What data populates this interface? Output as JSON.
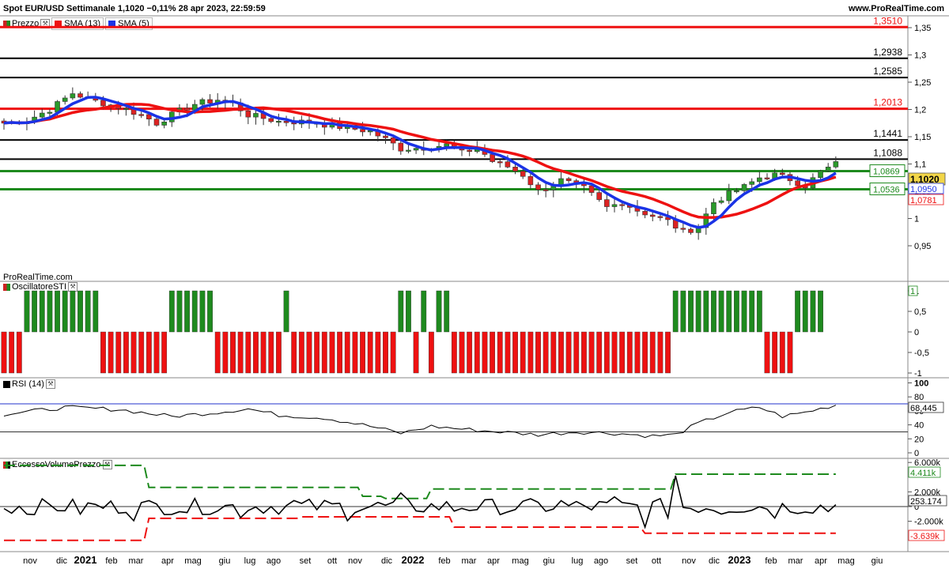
{
  "header": {
    "title": "Spot EUR/USD Settimanale 1,1020 −0,11% 28 apr 2023, 22:59:59",
    "url": "www.ProRealTime.com",
    "watermark": "ProRealTime.com"
  },
  "colors": {
    "green": "#1e8a1e",
    "red": "#e11",
    "blue": "#1a33e6",
    "black": "#000",
    "price_label_bg": "#f2d648"
  },
  "panels": [
    {
      "id": "price",
      "legend": [
        "Prezzo",
        "SMA (13)",
        "SMA (5)"
      ]
    },
    {
      "id": "sti",
      "legend": [
        "OscillatoreSTI"
      ]
    },
    {
      "id": "rsi",
      "legend": [
        "RSI (14)"
      ]
    },
    {
      "id": "evp",
      "legend": [
        "EccessoVolumePrezzo"
      ]
    }
  ],
  "chart_data": [
    {
      "type": "candlestick",
      "title": "Spot EUR/USD Settimanale",
      "timeframe": "weekly",
      "x_ticks": [
        "nov",
        "dic",
        "2021",
        "feb",
        "mar",
        "apr",
        "mag",
        "giu",
        "lug",
        "ago",
        "set",
        "ott",
        "nov",
        "dic",
        "2022",
        "feb",
        "mar",
        "apr",
        "mag",
        "giu",
        "lug",
        "ago",
        "set",
        "ott",
        "nov",
        "dic",
        "2023",
        "feb",
        "mar",
        "apr",
        "mag",
        "giu"
      ],
      "y_ticks": [
        "1,35",
        "1,3",
        "1,25",
        "1,2",
        "1,15",
        "1,1",
        "1,05",
        "1",
        "0,95"
      ],
      "ylim": [
        0.94,
        1.365
      ],
      "horizontal_levels": [
        {
          "value": 1.351,
          "label": "1,3510",
          "color": "red"
        },
        {
          "value": 1.2938,
          "label": "1,2938",
          "color": "black"
        },
        {
          "value": 1.2585,
          "label": "1,2585",
          "color": "black"
        },
        {
          "value": 1.2013,
          "label": "1,2013",
          "color": "red"
        },
        {
          "value": 1.1441,
          "label": "1,1441",
          "color": "black"
        },
        {
          "value": 1.1088,
          "label": "1,1088",
          "color": "black"
        },
        {
          "value": 1.0869,
          "label": "1,0869",
          "color": "green"
        },
        {
          "value": 1.0536,
          "label": "1,0536",
          "color": "green"
        }
      ],
      "last_values": {
        "price": "1,1020",
        "sma5": "1,0950",
        "sma13": "1,0781"
      },
      "close_keypoints": [
        [
          0,
          1.175
        ],
        [
          3,
          1.18
        ],
        [
          6,
          1.2
        ],
        [
          9,
          1.23
        ],
        [
          12,
          1.215
        ],
        [
          15,
          1.205
        ],
        [
          18,
          1.19
        ],
        [
          20,
          1.175
        ],
        [
          22,
          1.19
        ],
        [
          25,
          1.21
        ],
        [
          28,
          1.218
        ],
        [
          30,
          1.21
        ],
        [
          32,
          1.19
        ],
        [
          36,
          1.178
        ],
        [
          40,
          1.177
        ],
        [
          44,
          1.168
        ],
        [
          48,
          1.16
        ],
        [
          50,
          1.145
        ],
        [
          52,
          1.128
        ],
        [
          55,
          1.13
        ],
        [
          58,
          1.135
        ],
        [
          60,
          1.12
        ],
        [
          62,
          1.13
        ],
        [
          64,
          1.105
        ],
        [
          66,
          1.095
        ],
        [
          68,
          1.08
        ],
        [
          70,
          1.05
        ],
        [
          73,
          1.07
        ],
        [
          76,
          1.055
        ],
        [
          79,
          1.02
        ],
        [
          81,
          1.03
        ],
        [
          83,
          1.015
        ],
        [
          85,
          1.005
        ],
        [
          87,
          0.995
        ],
        [
          89,
          0.975
        ],
        [
          91,
          0.985
        ],
        [
          93,
          1.03
        ],
        [
          95,
          1.045
        ],
        [
          97,
          1.058
        ],
        [
          99,
          1.075
        ],
        [
          101,
          1.08
        ],
        [
          103,
          1.072
        ],
        [
          105,
          1.06
        ],
        [
          107,
          1.085
        ],
        [
          109,
          1.1
        ]
      ]
    },
    {
      "type": "bar",
      "title": "OscillatoreSTI",
      "y_ticks": [
        "1",
        "0,5",
        "0",
        "-0,5",
        "-1"
      ],
      "ylim": [
        -1.05,
        1.05
      ],
      "last_value": "1",
      "values_runs": [
        [
          -1,
          3
        ],
        [
          1,
          10
        ],
        [
          -1,
          9
        ],
        [
          1,
          6
        ],
        [
          -1,
          9
        ],
        [
          1,
          1
        ],
        [
          -1,
          14
        ],
        [
          1,
          2
        ],
        [
          -1,
          1
        ],
        [
          1,
          1
        ],
        [
          -1,
          1
        ],
        [
          1,
          2
        ],
        [
          -1,
          29
        ],
        [
          1,
          12
        ],
        [
          -1,
          4
        ],
        [
          1,
          4
        ]
      ]
    },
    {
      "type": "line",
      "title": "RSI (14)",
      "y_ticks": [
        "100",
        "80",
        "60",
        "40",
        "20",
        "0"
      ],
      "ylim": [
        0,
        100
      ],
      "reference_levels": [
        70,
        30
      ],
      "last_value": "68,445",
      "keypoints": [
        [
          0,
          55
        ],
        [
          8,
          65
        ],
        [
          15,
          62
        ],
        [
          22,
          52
        ],
        [
          28,
          58
        ],
        [
          32,
          63
        ],
        [
          36,
          54
        ],
        [
          42,
          50
        ],
        [
          48,
          38
        ],
        [
          52,
          28
        ],
        [
          56,
          38
        ],
        [
          60,
          34
        ],
        [
          65,
          30
        ],
        [
          70,
          26
        ],
        [
          75,
          30
        ],
        [
          80,
          28
        ],
        [
          85,
          24
        ],
        [
          88,
          26
        ],
        [
          91,
          42
        ],
        [
          95,
          58
        ],
        [
          99,
          65
        ],
        [
          102,
          52
        ],
        [
          105,
          58
        ],
        [
          109,
          68.4
        ]
      ]
    },
    {
      "type": "line",
      "title": "EccessoVolumePrezzo",
      "y_ticks": [
        "6.000k",
        "2.000k",
        "0",
        "-2.000k"
      ],
      "ylim": [
        -5200,
        6600
      ],
      "last_value": "253.174",
      "upper_band_label": "4.411k",
      "lower_band_label": "-3.639k",
      "upper_band_steps": [
        [
          0,
          5600
        ],
        [
          19,
          2600
        ],
        [
          47,
          1400
        ],
        [
          50,
          1100
        ],
        [
          56,
          2400
        ],
        [
          88,
          4411
        ]
      ],
      "lower_band_steps": [
        [
          0,
          -4600
        ],
        [
          19,
          -1600
        ],
        [
          39,
          -1400
        ],
        [
          59,
          -2800
        ],
        [
          84,
          -3639
        ]
      ]
    }
  ]
}
